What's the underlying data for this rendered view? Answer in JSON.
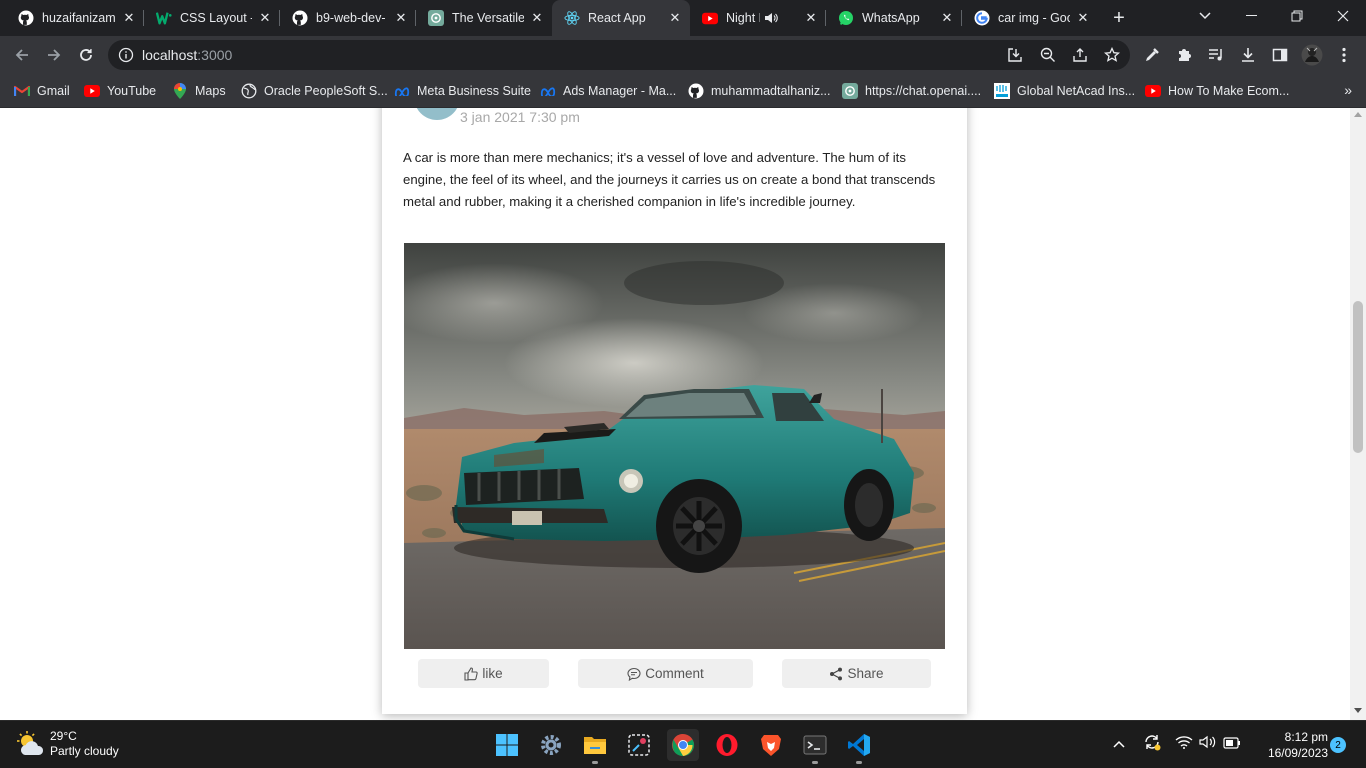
{
  "browser": {
    "tabs": [
      {
        "title": "huzaifanizam",
        "icon": "github-icon"
      },
      {
        "title": "CSS Layout - ",
        "icon": "w3schools-icon"
      },
      {
        "title": "b9-web-dev-",
        "icon": "github-icon"
      },
      {
        "title": "The Versatile ",
        "icon": "chatgpt-icon"
      },
      {
        "title": "React App",
        "icon": "react-icon",
        "active": true
      },
      {
        "title": "Night Dr",
        "icon": "youtube-icon",
        "audio": true
      },
      {
        "title": "WhatsApp",
        "icon": "whatsapp-icon"
      },
      {
        "title": "car img - Goo",
        "icon": "google-icon"
      }
    ],
    "new_tab_label": "+",
    "address": {
      "host": "localhost",
      "port": ":3000"
    },
    "bookmarks": [
      {
        "label": "Gmail",
        "icon": "gmail-icon"
      },
      {
        "label": "YouTube",
        "icon": "youtube-icon"
      },
      {
        "label": "Maps",
        "icon": "maps-icon"
      },
      {
        "label": "Oracle PeopleSoft S...",
        "icon": "globe-icon"
      },
      {
        "label": "Meta Business Suite",
        "icon": "meta-icon"
      },
      {
        "label": "Ads Manager - Ma...",
        "icon": "meta-icon"
      },
      {
        "label": "muhammadtalhaniz...",
        "icon": "github-icon"
      },
      {
        "label": "https://chat.openai....",
        "icon": "chatgpt-icon"
      },
      {
        "label": "Global NetAcad Ins...",
        "icon": "cisco-icon"
      },
      {
        "label": "How To Make Ecom...",
        "icon": "youtube-icon"
      }
    ],
    "bookmarks_more": "»"
  },
  "post": {
    "date": "3 jan 2021 7:30 pm",
    "text": "A car is more than mere mechanics; it's a vessel of love and adventure. The hum of its engine, the feel of its wheel, and the journeys it carries us on create a bond that transcends metal and rubber, making it a cherished companion in life's incredible journey.",
    "image_subject": "teal vintage muscle car on desert road under stormy sky",
    "actions": {
      "like": "like",
      "comment": "Comment",
      "share": "Share"
    }
  },
  "taskbar": {
    "weather": {
      "temp": "29°C",
      "desc": "Partly cloudy"
    },
    "clock": {
      "time": "8:12 pm",
      "date": "16/09/2023"
    },
    "notification_count": "2"
  },
  "colors": {
    "chrome_dark": "#202124",
    "chrome_toolbar": "#35363a",
    "taskbar": "#1c1c1c",
    "accent": "#4cc2ff",
    "car": "#2a8a84"
  }
}
